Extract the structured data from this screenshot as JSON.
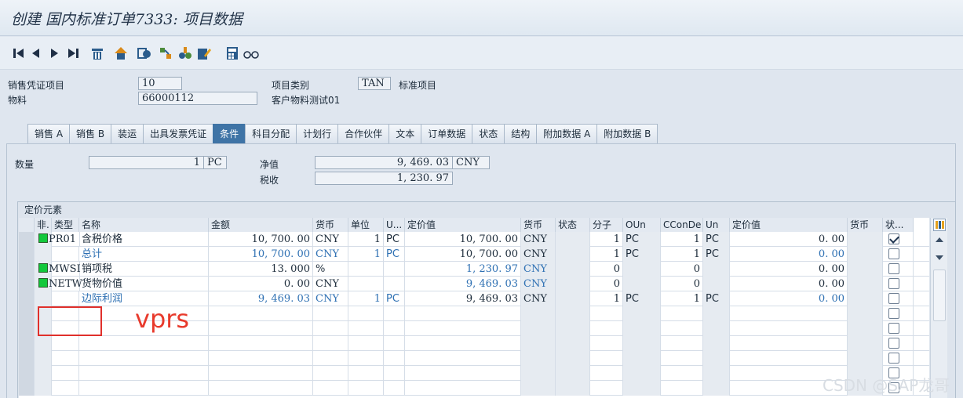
{
  "title": "创建 国内标准订单7333: 项目数据",
  "toolbar": {
    "icons": [
      "first-icon",
      "prev-icon",
      "next-icon",
      "last-icon",
      "delete-icon",
      "home-icon",
      "copy-icon",
      "config-icon",
      "tree-icon",
      "edit-icon",
      "calc-icon",
      "glasses-icon"
    ]
  },
  "header": {
    "item_label": "销售凭证项目",
    "item_value": "10",
    "material_label": "物料",
    "material_value": "66000112",
    "category_label": "项目类别",
    "category_value": "TAN",
    "category_text": "标准项目",
    "material_text": "客户物料测试01"
  },
  "tabs": [
    "销售 A",
    "销售 B",
    "装运",
    "出具发票凭证",
    "条件",
    "科目分配",
    "计划行",
    "合作伙伴",
    "文本",
    "订单数据",
    "状态",
    "结构",
    "附加数据 A",
    "附加数据 B"
  ],
  "active_tab": "条件",
  "summary": {
    "qty_label": "数量",
    "qty_value": "1",
    "qty_unit": "PC",
    "net_label": "净值",
    "net_value": "9, 469. 03",
    "net_currency": "CNY",
    "tax_label": "税收",
    "tax_value": "1, 230. 97"
  },
  "group_title": "定价元素",
  "columns": [
    "非.",
    "类型",
    "名称",
    "金额",
    "货币",
    "单位",
    "U...",
    "定价值",
    "货币",
    "状态",
    "分子",
    "OUn",
    "CConDe",
    "Un",
    "定价值",
    "货币",
    "状..."
  ],
  "rows": [
    {
      "ctype": "PR01",
      "name": "含税价格",
      "amount": "10, 700. 00",
      "cur": "CNY",
      "unit": "1",
      "uom": "PC",
      "cvalue": "10, 700. 00",
      "cur2": "CNY",
      "num": "1",
      "oun": "PC",
      "ccon": "1",
      "un": "PC",
      "pv": "0. 00",
      "checked": true,
      "blue": false,
      "icon": true
    },
    {
      "ctype": "",
      "name": "总计",
      "amount": "10, 700. 00",
      "cur": "CNY",
      "unit": "1",
      "uom": "PC",
      "cvalue": "10, 700. 00",
      "cur2": "CNY",
      "num": "1",
      "oun": "PC",
      "ccon": "1",
      "un": "PC",
      "pv": "0. 00",
      "checked": false,
      "blue": true,
      "icon": false
    },
    {
      "ctype": "MWSI",
      "name": "销项税",
      "amount": "13. 000",
      "cur": "%",
      "unit": "",
      "uom": "",
      "cvalue": "1, 230. 97",
      "cur2": "CNY",
      "num": "0",
      "oun": "",
      "ccon": "0",
      "un": "",
      "pv": "0. 00",
      "checked": false,
      "blue": false,
      "icon": true
    },
    {
      "ctype": "NETW",
      "name": "货物价值",
      "amount": "0. 00",
      "cur": "CNY",
      "unit": "",
      "uom": "",
      "cvalue": "9, 469. 03",
      "cur2": "CNY",
      "num": "0",
      "oun": "",
      "ccon": "0",
      "un": "",
      "pv": "0. 00",
      "checked": false,
      "blue": false,
      "icon": true
    },
    {
      "ctype": "",
      "name": "边际利润",
      "amount": "9, 469. 03",
      "cur": "CNY",
      "unit": "1",
      "uom": "PC",
      "cvalue": "9, 469. 03",
      "cur2": "CNY",
      "num": "1",
      "oun": "PC",
      "ccon": "1",
      "un": "PC",
      "pv": "0. 00",
      "checked": false,
      "blue": true,
      "icon": false
    }
  ],
  "annotation": "vprs",
  "watermark": "CSDN @SAP龙哥"
}
